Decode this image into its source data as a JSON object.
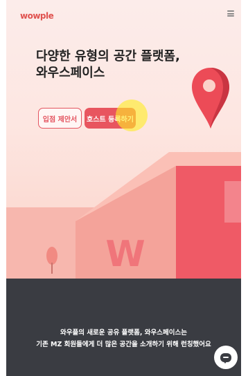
{
  "header": {
    "logo_text": "wowple",
    "menu_icon": "hamburger-menu-icon"
  },
  "hero": {
    "title_line1": "다양한 유형의 공간 플랫폼,",
    "title_line2": "와우스페이스",
    "buttons": {
      "proposal_label": "입점 제안서",
      "host_register_label": "호스트 등록하기"
    },
    "illustration_mark": "W"
  },
  "footer": {
    "line1": "와우플의 새로운 공유 플랫폼, 와우스페이스는",
    "line2": "기존 MZ 회원들에게 더 많은 공간을 소개하기 위해 런칭했어요"
  },
  "chat_button": {
    "icon": "chat-icon"
  },
  "colors": {
    "accent": "#e8555f",
    "hero_bg": "#fde6e1",
    "footer_bg": "#3a3c42",
    "highlight": "#ffec28"
  }
}
